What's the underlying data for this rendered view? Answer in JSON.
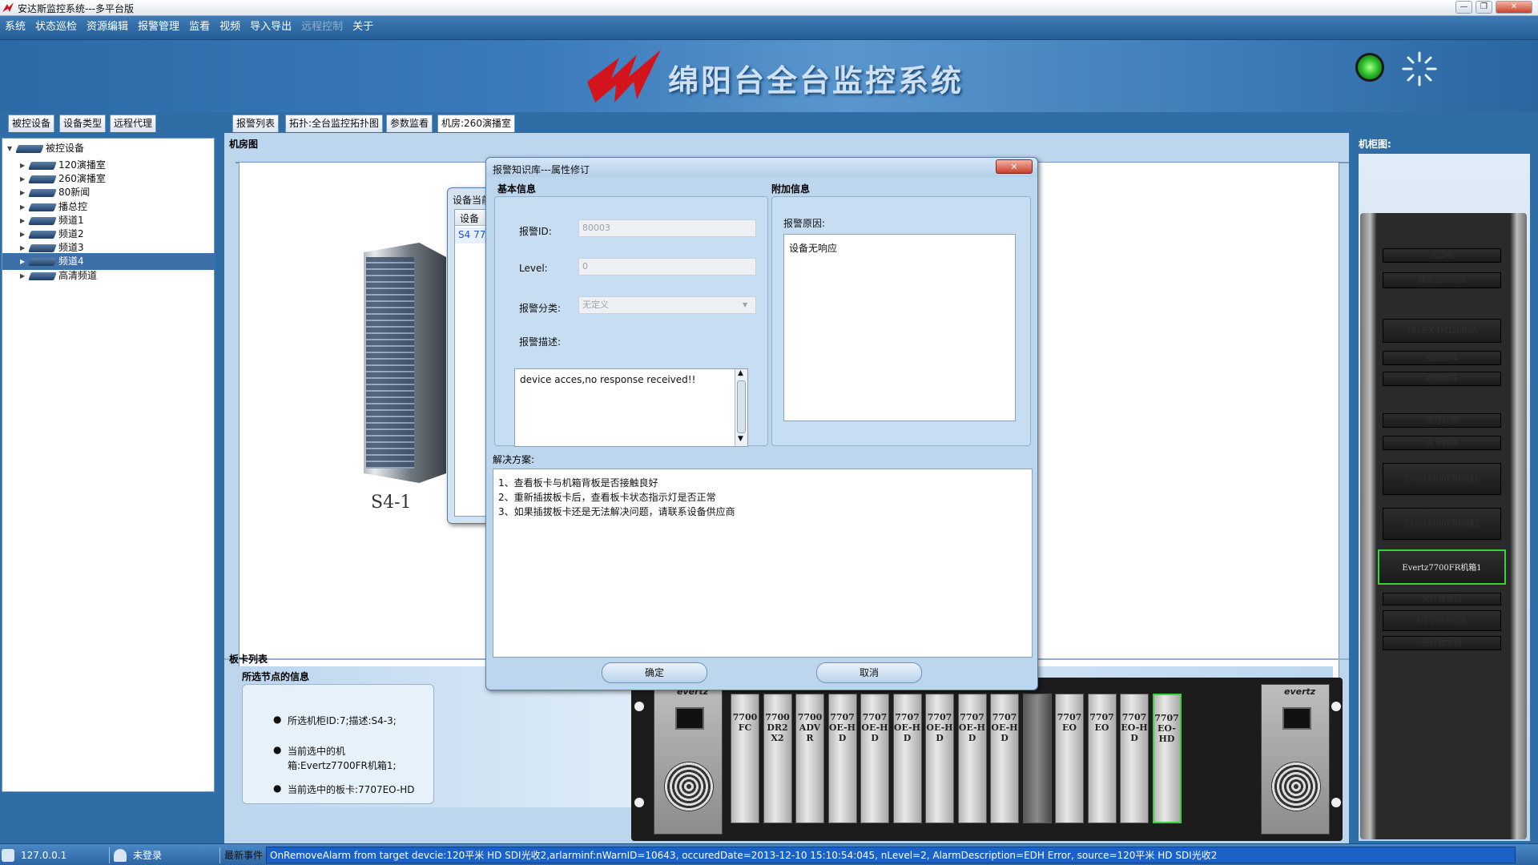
{
  "window": {
    "title": "安达斯监控系统---多平台版"
  },
  "menu": [
    "系统",
    "状态巡检",
    "资源编辑",
    "报警管理",
    "监看",
    "视频",
    "导入导出",
    "远程控制",
    "关于"
  ],
  "menu_disabled_index": 7,
  "banner": {
    "title": "绵阳台全台监控系统"
  },
  "left_tabs": [
    "被控设备",
    "设备类型",
    "远程代理"
  ],
  "tree": {
    "root": "被控设备",
    "items": [
      "120演播室",
      "260演播室",
      "80新闻",
      "播总控",
      "频道1",
      "频道2",
      "频道3",
      "频道4",
      "高清频道"
    ],
    "selected_index": 7
  },
  "main_tabs": [
    "报警列表",
    "拓扑:全台监控拓扑图",
    "参数监看",
    "机房:260演播室"
  ],
  "room": {
    "label": "机房图",
    "cabinet_label": "S4-1"
  },
  "device_window": {
    "title": "设备当前",
    "col": "设备",
    "row": "S4 770"
  },
  "board_list": {
    "label": "板卡列表"
  },
  "node_info": {
    "title": "所选节点的信息",
    "lines": [
      "所选机柜ID:7;描述:S4-3;",
      "当前选中的机箱:Evertz7700FR机箱1;",
      "当前选中的板卡:7707EO-HD"
    ]
  },
  "chassis": {
    "brand": "evertz",
    "slots": [
      "7700FC",
      "7700DR2X2",
      "7700ADVR",
      "7707OE-HD",
      "7707OE-HD",
      "7707OE-HD",
      "7707OE-HD",
      "7707OE-HD",
      "7707OE-HD",
      "",
      "7707EO",
      "7707EO",
      "7707EO-HD",
      "7707EO-HD"
    ],
    "selected_slot": 13
  },
  "rack": {
    "label": "机柜图:",
    "units": [
      "光口收",
      "播出自动切换",
      "TELEX DTI2000A",
      "视频矩阵",
      "视频矩阵",
      "信号转换",
      "信号转换",
      "Evertz500FR机箱1",
      "Evertz500FR机箱2",
      "Evertz7700FR机箱1",
      "光纤收发器",
      "GY-1610光端",
      "光纤收发器"
    ],
    "selected_unit": 9
  },
  "dialog": {
    "title": "报警知识库---属性修订",
    "basic_section": "基本信息",
    "extra_section": "附加信息",
    "alarm_id_label": "报警ID:",
    "alarm_id_value": "80003",
    "level_label": "Level:",
    "level_value": "0",
    "category_label": "报警分类:",
    "category_value": "无定义",
    "desc_label": "报警描述:",
    "desc_value": "device acces,no response received!!",
    "reason_label": "报警原因:",
    "reason_value": "设备无响应",
    "solution_label": "解决方案:",
    "solution_lines": [
      "1、查看板卡与机箱背板是否接触良好",
      "2、重新插拔板卡后，查看板卡状态指示灯是否正常",
      "3、如果插拔板卡还是无法解决问题，请联系设备供应商"
    ],
    "ok": "确定",
    "cancel": "取消"
  },
  "status": {
    "ip": "127.0.0.1",
    "login": "未登录",
    "event_label": "最新事件",
    "event_text": "OnRemoveAlarm from target devcie:120平米 HD SDI光收2,arlarminf:nWarnID=10643, occuredDate=2013-12-10 15:10:54:045, nLevel=2, AlarmDescription=EDH Error, source=120平米 HD SDI光收2"
  },
  "colors": {
    "accent": "#2d6aa4",
    "selected": "#3d6fa8",
    "highlight": "#3ad13a",
    "status_on": "#2ec22e"
  }
}
